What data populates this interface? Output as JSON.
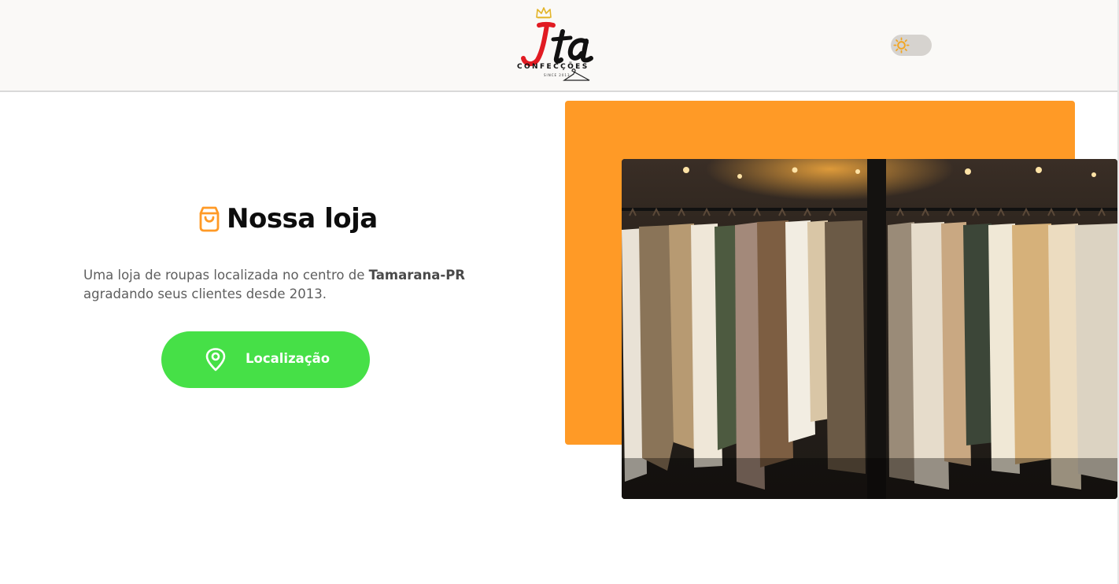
{
  "header": {
    "logo": {
      "mark_text": "Ita",
      "wordmark": "CONFECÇÕES",
      "since": "SINCE 2013",
      "icons": [
        "crown-icon",
        "hanger-icon"
      ]
    },
    "theme_toggle": {
      "icon": "sun-icon",
      "state": "light"
    }
  },
  "main": {
    "title_icon": "shopping-bag-icon",
    "title": "Nossa loja",
    "description": {
      "before": "Uma loja de roupas localizada no centro de ",
      "highlight": "Tamarana-PR",
      "after": " agradando seus clientes desde 2013."
    },
    "location_button": {
      "icon": "map-pin-icon",
      "label": "Localização"
    },
    "photo_alt": "clothing-rack-photo"
  },
  "colors": {
    "accent_orange": "#ff9a26",
    "button_green": "#46e047",
    "logo_red": "#e11b22",
    "crown_gold": "#e3b52a"
  }
}
